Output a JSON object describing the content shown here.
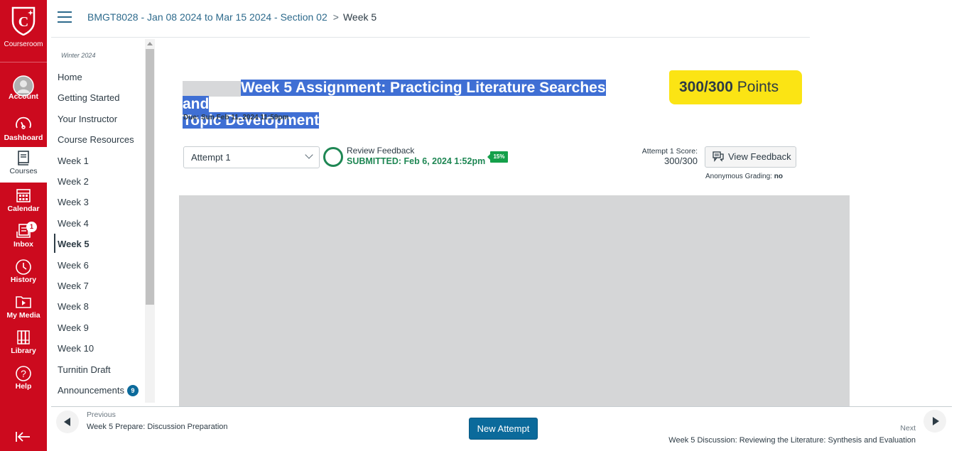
{
  "global_nav": {
    "logo_label": "Courseroom",
    "items": [
      {
        "label": "Account",
        "icon": "avatar-icon"
      },
      {
        "label": "Dashboard",
        "icon": "dashboard-icon"
      },
      {
        "label": "Courses",
        "icon": "courses-icon",
        "active": true
      },
      {
        "label": "Calendar",
        "icon": "calendar-icon"
      },
      {
        "label": "Inbox",
        "icon": "inbox-icon",
        "badge": "1"
      },
      {
        "label": "History",
        "icon": "clock-icon"
      },
      {
        "label": "My Media",
        "icon": "media-icon"
      },
      {
        "label": "Library",
        "icon": "library-icon"
      },
      {
        "label": "Help",
        "icon": "help-icon"
      }
    ],
    "collapse_icon": "collapse-arrow-icon"
  },
  "header": {
    "breadcrumb": {
      "course": "BMGT8028 - Jan 08 2024 to Mar 15 2024 - Section 02",
      "separator": ">",
      "current": "Week 5"
    }
  },
  "course_nav": {
    "term": "Winter 2024",
    "items": [
      {
        "label": "Home"
      },
      {
        "label": "Getting Started"
      },
      {
        "label": "Your Instructor"
      },
      {
        "label": "Course Resources"
      },
      {
        "label": "Week 1"
      },
      {
        "label": "Week 2"
      },
      {
        "label": "Week 3"
      },
      {
        "label": "Week 4"
      },
      {
        "label": "Week 5",
        "active": true
      },
      {
        "label": "Week 6"
      },
      {
        "label": "Week 7"
      },
      {
        "label": "Week 8"
      },
      {
        "label": "Week 9"
      },
      {
        "label": "Week 10"
      },
      {
        "label": "Turnitin Draft"
      },
      {
        "label": "Announcements",
        "badge": "9"
      }
    ]
  },
  "assignment": {
    "title_line1": "Week 5 Assignment: Practicing Literature Searches and",
    "title_line2": "Topic Development",
    "due": "Due: Sun Feb 11, 2024 11:59pm",
    "points_score": "300/300",
    "points_label": "Points",
    "attempt_select": "Attempt 1",
    "review_feedback": "Review Feedback",
    "submitted": "SUBMITTED: Feb 6, 2024 1:52pm",
    "similarity": "15%",
    "score_label": "Attempt 1 Score:",
    "score_value": "300/300",
    "view_feedback": "View Feedback",
    "anon_label": "Anonymous Grading:",
    "anon_value": "no"
  },
  "footer": {
    "previous_label": "Previous",
    "previous_title": "Week 5 Prepare: Discussion Preparation",
    "new_attempt": "New Attempt",
    "next_label": "Next",
    "next_title": "Week 5 Discussion: Reviewing the Literature: Synthesis and Evaluation"
  },
  "colors": {
    "brand_red": "#cc0a1e",
    "link_blue": "#2d6a8c",
    "primary_button": "#0b6a9b",
    "success_green": "#1f8754",
    "highlight_yellow": "#fbe414",
    "selection_blue": "#3f6fd4"
  }
}
